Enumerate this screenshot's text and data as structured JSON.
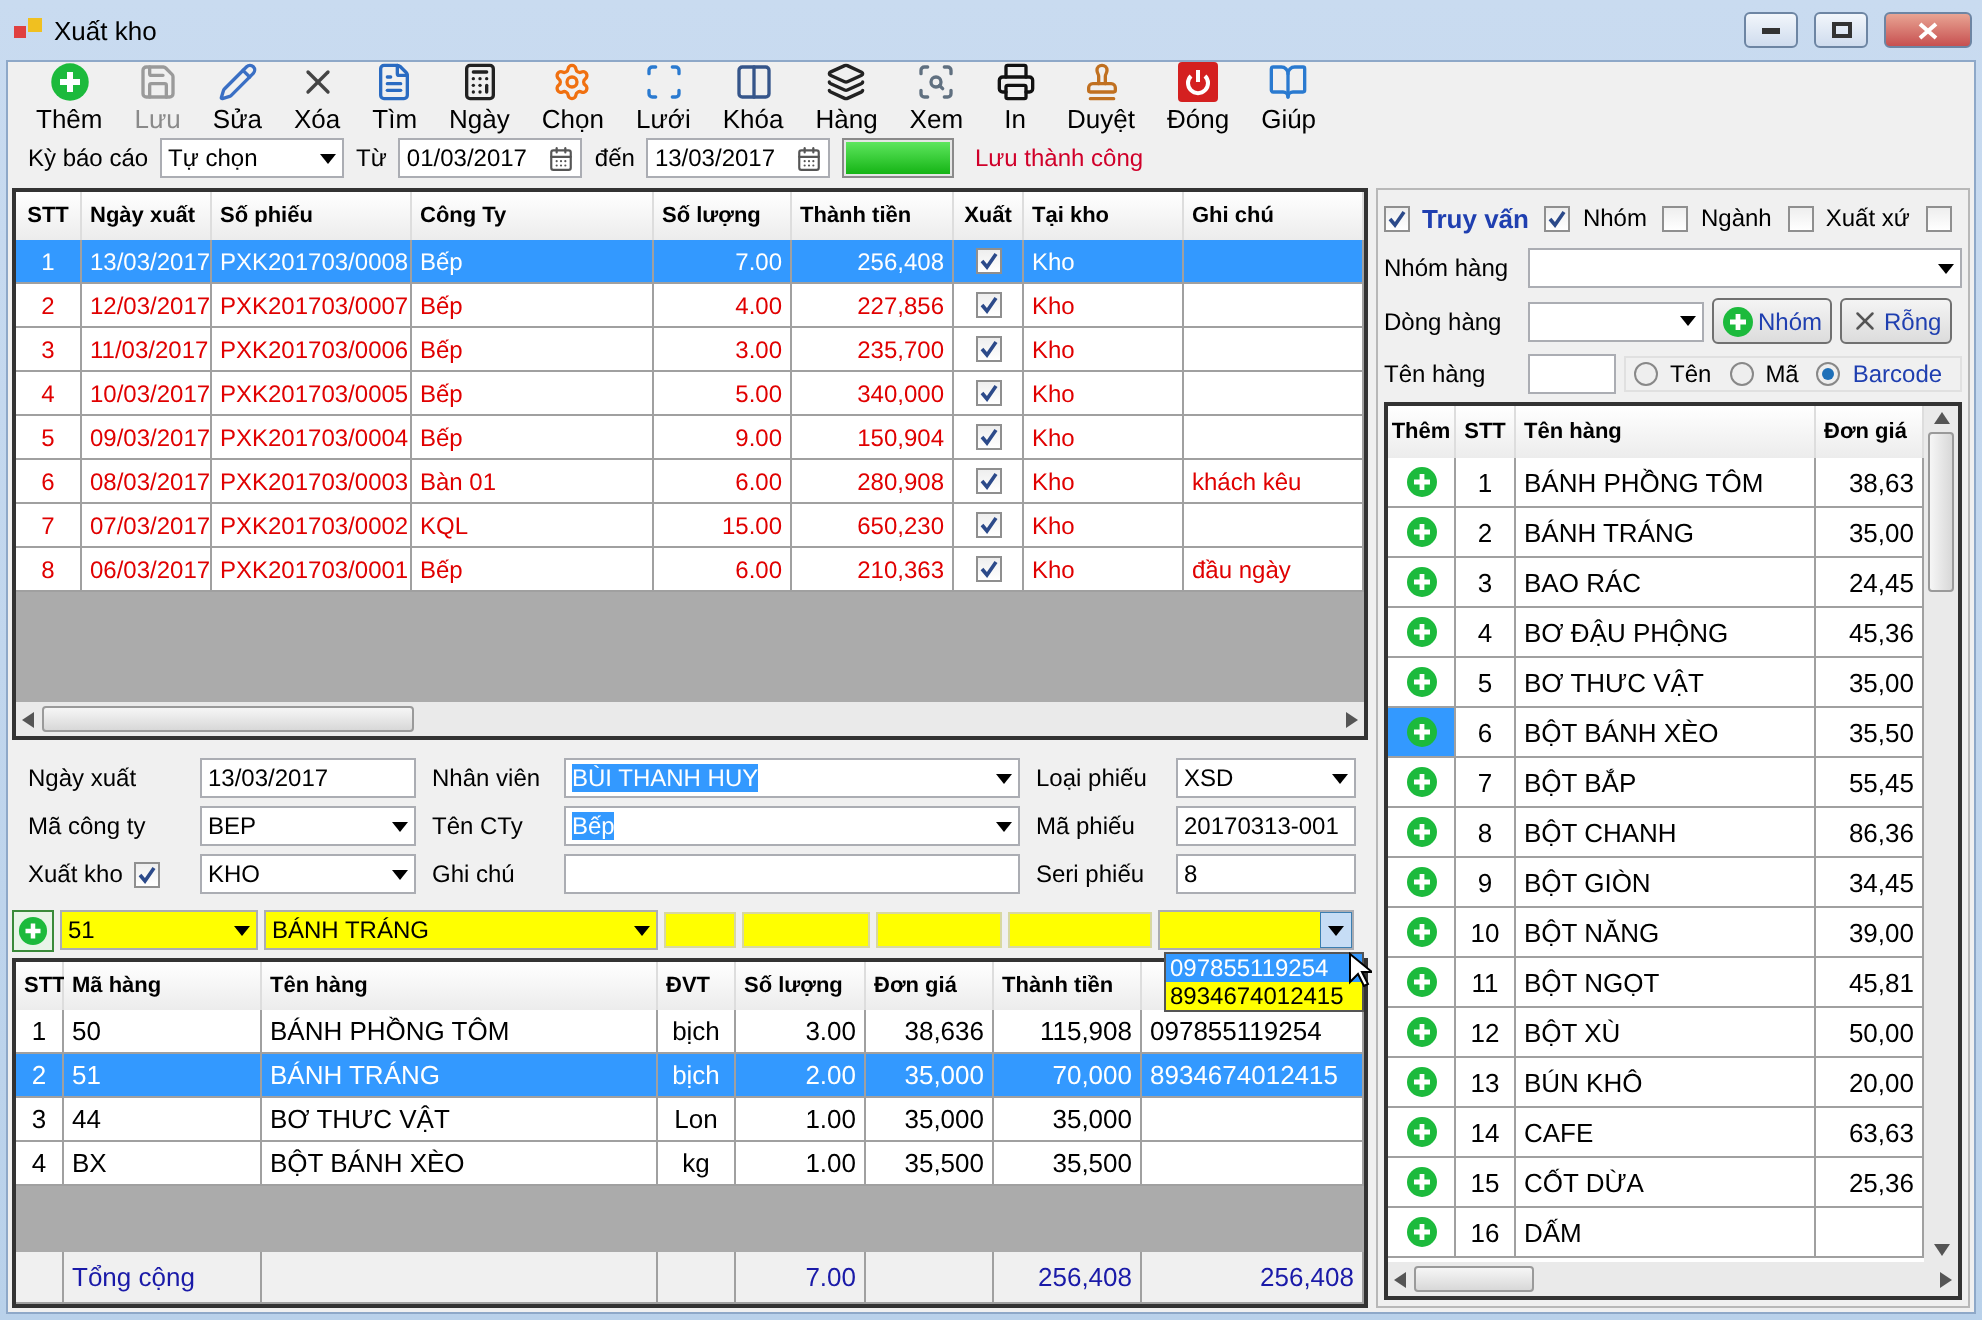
{
  "window": {
    "title": "Xuất kho"
  },
  "toolbar": [
    {
      "label": "Thêm",
      "disabled": false
    },
    {
      "label": "Lưu",
      "disabled": true
    },
    {
      "label": "Sửa",
      "disabled": false
    },
    {
      "label": "Xóa",
      "disabled": false
    },
    {
      "label": "Tìm",
      "disabled": false
    },
    {
      "label": "Ngày",
      "disabled": false
    },
    {
      "label": "Chọn",
      "disabled": false
    },
    {
      "label": "Lưới",
      "disabled": false
    },
    {
      "label": "Khóa",
      "disabled": false
    },
    {
      "label": "Hàng",
      "disabled": false
    },
    {
      "label": "Xem",
      "disabled": false
    },
    {
      "label": "In",
      "disabled": false
    },
    {
      "label": "Duyệt",
      "disabled": false
    },
    {
      "label": "Đóng",
      "disabled": false
    },
    {
      "label": "Giúp",
      "disabled": false
    }
  ],
  "filter": {
    "period_label": "Kỳ báo cáo",
    "period": "Tự chọn",
    "from_label": "Từ",
    "from": "01/03/2017",
    "to_label": "đến",
    "to": "13/03/2017",
    "progress": {
      "level": 1
    },
    "status": "Lưu thành công"
  },
  "receipts": {
    "columns": [
      "STT",
      "Ngày xuất",
      "Số phiếu",
      "Công Ty",
      "Số lượng",
      "Thành tiền",
      "Xuất",
      "Tại kho",
      "Ghi chú"
    ],
    "rows": [
      {
        "stt": "1",
        "date": "13/03/2017",
        "number": "PXK201703/0008",
        "company": "Bếp",
        "qty": "7.00",
        "amount": "256,408",
        "exported": true,
        "warehouse": "Kho",
        "selected": true
      },
      {
        "stt": "2",
        "date": "12/03/2017",
        "number": "PXK201703/0007",
        "company": "Bếp",
        "qty": "4.00",
        "amount": "227,856",
        "exported": true,
        "warehouse": "Kho",
        "selected": false
      },
      {
        "stt": "3",
        "date": "11/03/2017",
        "number": "PXK201703/0006",
        "company": "Bếp",
        "qty": "3.00",
        "amount": "235,700",
        "exported": true,
        "warehouse": "Kho",
        "selected": false
      },
      {
        "stt": "4",
        "date": "10/03/2017",
        "number": "PXK201703/0005",
        "company": "Bếp",
        "qty": "5.00",
        "amount": "340,000",
        "exported": true,
        "warehouse": "Kho",
        "selected": false
      },
      {
        "stt": "5",
        "date": "09/03/2017",
        "number": "PXK201703/0004",
        "company": "Bếp",
        "qty": "9.00",
        "amount": "150,904",
        "exported": true,
        "warehouse": "Kho",
        "selected": false
      },
      {
        "stt": "6",
        "date": "08/03/2017",
        "number": "PXK201703/0003",
        "company": "Bàn 01",
        "qty": "6.00",
        "amount": "280,908",
        "exported": true,
        "warehouse": "Kho",
        "note": "khách kêu",
        "selected": false
      },
      {
        "stt": "7",
        "date": "07/03/2017",
        "number": "PXK201703/0002",
        "company": "KQL",
        "qty": "15.00",
        "amount": "650,230",
        "exported": true,
        "warehouse": "Kho",
        "selected": false
      },
      {
        "stt": "8",
        "date": "06/03/2017",
        "number": "PXK201703/0001",
        "company": "Bếp",
        "qty": "6.00",
        "amount": "210,363",
        "exported": true,
        "warehouse": "Kho",
        "note": "đầu ngày",
        "selected": false
      }
    ]
  },
  "form": {
    "fields": [
      {
        "label": "Ngày xuất",
        "value": "13/03/2017",
        "kind": "text"
      },
      {
        "label": "Nhân viên",
        "value": "BÙI THANH HUY",
        "kind": "combo",
        "highlighted": true
      },
      {
        "label": "Loại phiếu",
        "value": "XSD",
        "kind": "combo",
        "highlighted": false
      },
      {
        "label": "Mã công ty",
        "value": "BEP",
        "kind": "combo",
        "highlighted": false
      },
      {
        "label": "Tên CTy",
        "value": "Bếp",
        "kind": "combo",
        "highlighted": true
      },
      {
        "label": "Mã phiếu",
        "value": "20170313-001",
        "kind": "text"
      },
      {
        "label": "Xuất kho",
        "value": "KHO",
        "kind": "check-combo",
        "checked": true
      },
      {
        "label": "Ghi chú",
        "kind": "text"
      },
      {
        "label": "Seri phiếu",
        "value": "8",
        "kind": "text"
      }
    ]
  },
  "entry": {
    "code": "51",
    "name": "BÁNH TRÁNG",
    "barcode_options": [
      {
        "label": "097855119254",
        "selected": true
      },
      {
        "label": "8934674012415",
        "selected": false
      }
    ]
  },
  "items": {
    "columns": [
      "STT",
      "Mã hàng",
      "Tên hàng",
      "ĐVT",
      "Số lượng",
      "Đơn giá",
      "Thành tiền"
    ],
    "rows": [
      {
        "stt": "1",
        "code": "50",
        "name": "BÁNH PHỒNG TÔM",
        "unit": "bịch",
        "qty": "3.00",
        "price": "38,636",
        "amount": "115,908",
        "barcode": "097855119254",
        "selected": false
      },
      {
        "stt": "2",
        "code": "51",
        "name": "BÁNH TRÁNG",
        "unit": "bịch",
        "qty": "2.00",
        "price": "35,000",
        "amount": "70,000",
        "barcode": "8934674012415",
        "selected": true
      },
      {
        "stt": "3",
        "code": "44",
        "name": "BƠ THƯC VẬT",
        "unit": "Lon",
        "qty": "1.00",
        "price": "35,000",
        "amount": "35,000",
        "selected": false
      },
      {
        "stt": "4",
        "code": "BX",
        "name": "BỘT BÁNH XÈO",
        "unit": "kg",
        "qty": "1.00",
        "price": "35,500",
        "amount": "35,500",
        "selected": false
      }
    ],
    "total": {
      "label": "Tổng cộng",
      "qty": "7.00",
      "amount": "256,408",
      "column_8": "256,408"
    }
  },
  "search": {
    "checks": [
      {
        "label": "Truy vấn",
        "checked": true,
        "kind": "main"
      },
      {
        "label": "Nhóm",
        "checked": true,
        "kind": "plain"
      },
      {
        "label": "Ngành",
        "checked": false,
        "kind": "plain"
      },
      {
        "label": "Xuất xứ",
        "checked": false,
        "kind": "plain"
      },
      {
        "checked": false,
        "kind": "plain"
      }
    ],
    "group_label": "Nhóm hàng",
    "line_label": "Dòng hàng",
    "add_group": "Nhóm",
    "clear": "Rỗng",
    "name_label": "Tên hàng",
    "modes": [
      {
        "label": "Tên",
        "selected": false
      },
      {
        "label": "Mã",
        "selected": false
      },
      {
        "label": "Barcode",
        "selected": true
      }
    ]
  },
  "products": {
    "columns": [
      "Thêm",
      "STT",
      "Tên hàng",
      "Đơn giá"
    ],
    "rows": [
      {
        "stt": "1",
        "name": "BÁNH PHỒNG TÔM",
        "price": "38,63",
        "selected": false
      },
      {
        "stt": "2",
        "name": "BÁNH TRÁNG",
        "price": "35,00",
        "selected": false
      },
      {
        "stt": "3",
        "name": "BAO RÁC",
        "price": "24,45",
        "selected": false
      },
      {
        "stt": "4",
        "name": "BƠ ĐẬU PHỘNG",
        "price": "45,36",
        "selected": false
      },
      {
        "stt": "5",
        "name": "BƠ THƯC VẬT",
        "price": "35,00",
        "selected": false
      },
      {
        "stt": "6",
        "name": "BỘT BÁNH XÈO",
        "price": "35,50",
        "selected": true
      },
      {
        "stt": "7",
        "name": "BỘT BẮP",
        "price": "55,45",
        "selected": false
      },
      {
        "stt": "8",
        "name": "BỘT CHANH",
        "price": "86,36",
        "selected": false
      },
      {
        "stt": "9",
        "name": "BỘT GIÒN",
        "price": "34,45",
        "selected": false
      },
      {
        "stt": "10",
        "name": "BỘT NĂNG",
        "price": "39,00",
        "selected": false
      },
      {
        "stt": "11",
        "name": "BỘT NGỌT",
        "price": "45,81",
        "selected": false
      },
      {
        "stt": "12",
        "name": "BỘT XÙ",
        "price": "50,00",
        "selected": false
      },
      {
        "stt": "13",
        "name": "BÚN KHÔ",
        "price": "20,00",
        "selected": false
      },
      {
        "stt": "14",
        "name": "CAFE",
        "price": "63,63",
        "selected": false
      },
      {
        "stt": "15",
        "name": "CỐT DỪA",
        "price": "25,36",
        "selected": false
      },
      {
        "stt": "16",
        "name": "DẤM",
        "selected": false
      }
    ]
  }
}
